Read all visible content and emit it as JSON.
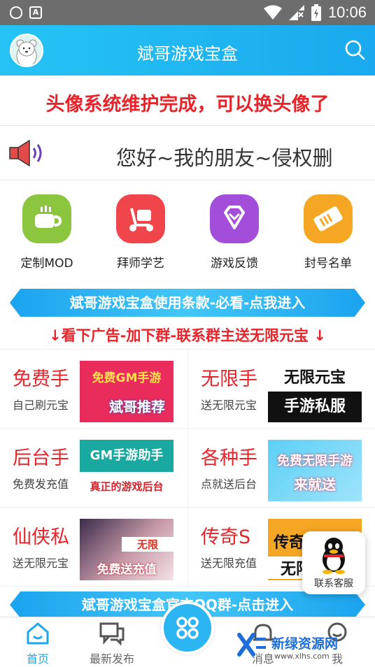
{
  "status_bar": {
    "time": "10:06"
  },
  "header": {
    "title": "斌哥游戏宝盒"
  },
  "notice": {
    "text": "头像系统维护完成，可以换头像了"
  },
  "marquee": {
    "text": "您好~我的朋友~侵权删"
  },
  "quick_actions": [
    {
      "label": "定制MOD",
      "icon": "coffee-cup-icon",
      "color": "#8cc63f"
    },
    {
      "label": "拜师学艺",
      "icon": "scooter-icon",
      "color": "#f0454a"
    },
    {
      "label": "游戏反馈",
      "icon": "diamond-icon",
      "color": "#a34ddb"
    },
    {
      "label": "封号名单",
      "icon": "ticket-icon",
      "color": "#f5a623"
    }
  ],
  "banner_terms": {
    "text": "斌哥游戏宝盒使用条款-必看-点我进入"
  },
  "ad_line": {
    "text": "↓看下广告-加下群-联系群主送无限元宝 ↓"
  },
  "games": [
    {
      "title": "免费手",
      "subtitle": "自己刷元宝",
      "img_line1": "免费GM手游",
      "img_line2": "斌哥推荐"
    },
    {
      "title": "无限手",
      "subtitle": "送无限元宝",
      "img_line1": "无限元宝",
      "img_line2": "手游私服"
    },
    {
      "title": "后台手",
      "subtitle": "免费发充值",
      "img_line1": "GM手游助手",
      "img_line2": "真正的游戏后台"
    },
    {
      "title": "各种手",
      "subtitle": "点就送后台",
      "img_line1": "免费无限手游",
      "img_line2": "来就送"
    },
    {
      "title": "仙侠私",
      "subtitle": "送无限元宝",
      "img_line1": "无限",
      "img_line2": "免费送充值"
    },
    {
      "title": "传奇S",
      "subtitle": "送无限充值",
      "img_line1": "传奇",
      "img_line2": "无限"
    }
  ],
  "banner_qq": {
    "text": "斌哥游戏宝盒官方QQ群-点击进入"
  },
  "float_service": {
    "label": "联系客服"
  },
  "bottom_nav": [
    {
      "label": "首页",
      "icon": "home-icon",
      "active": true
    },
    {
      "label": "最新发布",
      "icon": "chat-bubbles-icon",
      "active": false
    },
    {
      "label": "消息",
      "icon": "bell-icon",
      "active": false
    },
    {
      "label": "我",
      "icon": "user-icon",
      "active": false
    }
  ],
  "watermark": {
    "brand": "新绿资源网",
    "url": "www.xlhs.com"
  },
  "colors": {
    "accent": "#1aa9ee",
    "alert_red": "#e8242a"
  }
}
